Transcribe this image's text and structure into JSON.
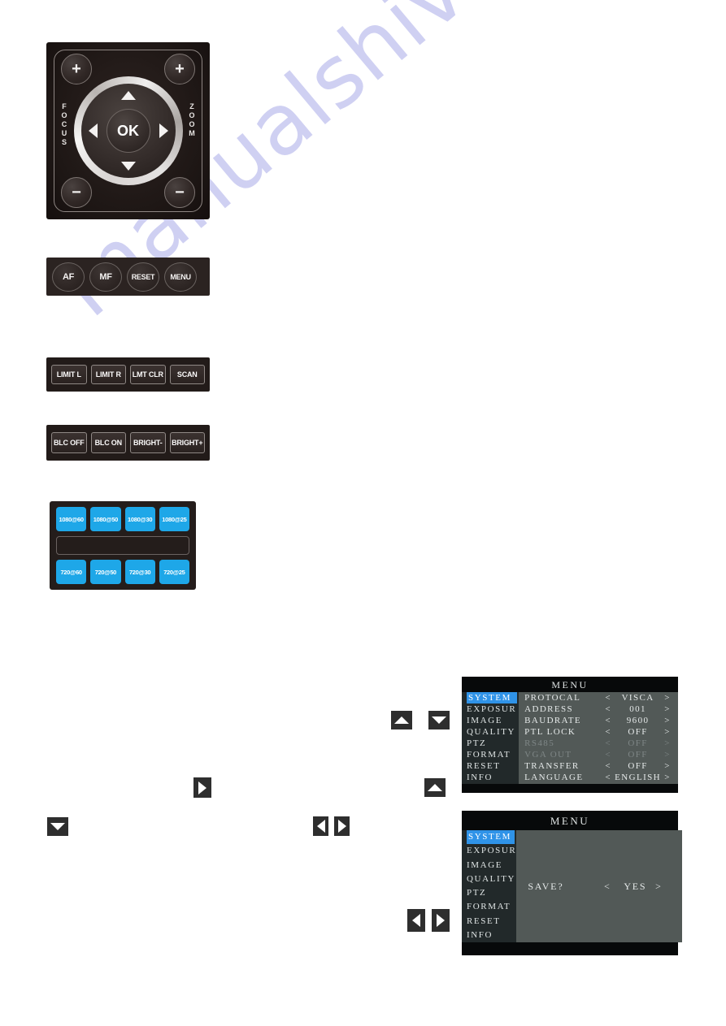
{
  "watermark": {
    "text": "manualshive.com"
  },
  "joystick": {
    "focus_label": "FOCUS",
    "zoom_label": "ZOOM",
    "ok_label": "OK",
    "focus_plus": "+",
    "focus_minus": "−",
    "zoom_plus": "+",
    "zoom_minus": "−",
    "arrows": {
      "up": "up-arrow-icon",
      "down": "down-arrow-icon",
      "left": "left-arrow-icon",
      "right": "right-arrow-icon"
    }
  },
  "round_buttons": [
    {
      "label": "AF"
    },
    {
      "label": "MF"
    },
    {
      "label": "RESET"
    },
    {
      "label": "MENU"
    }
  ],
  "limit_buttons": [
    {
      "label": "LIMIT L"
    },
    {
      "label": "LIMIT R"
    },
    {
      "label": "LMT CLR"
    },
    {
      "label": "SCAN"
    }
  ],
  "blc_buttons": [
    {
      "label": "BLC OFF"
    },
    {
      "label": "BLC ON"
    },
    {
      "label": "BRIGHT-"
    },
    {
      "label": "BRIGHT+"
    }
  ],
  "resolution_keypad": {
    "accent_color": "#1ea7e8",
    "row_top": [
      {
        "label": "1080@60"
      },
      {
        "label": "1080@50"
      },
      {
        "label": "1080@30"
      },
      {
        "label": "1080@25"
      }
    ],
    "row_bottom": [
      {
        "label": "720@60"
      },
      {
        "label": "720@50"
      },
      {
        "label": "720@30"
      },
      {
        "label": "720@25"
      }
    ]
  },
  "osd_main": {
    "title": "MENU",
    "highlight_color": "#2f93e8",
    "sidebar": [
      {
        "label": "SYSTEM",
        "selected": true
      },
      {
        "label": "EXPOSUR",
        "selected": false
      },
      {
        "label": "IMAGE",
        "selected": false
      },
      {
        "label": "QUALITY",
        "selected": false
      },
      {
        "label": "PTZ",
        "selected": false
      },
      {
        "label": "FORMAT",
        "selected": false
      },
      {
        "label": "RESET",
        "selected": false
      },
      {
        "label": "INFO",
        "selected": false
      }
    ],
    "rows": [
      {
        "label": "PROTOCAL",
        "left": "<",
        "value": "VISCA",
        "right": ">",
        "dim": false
      },
      {
        "label": "ADDRESS",
        "left": "<",
        "value": "001",
        "right": ">",
        "dim": false
      },
      {
        "label": "BAUDRATE",
        "left": "<",
        "value": "9600",
        "right": ">",
        "dim": false
      },
      {
        "label": "PTL LOCK",
        "left": "<",
        "value": "OFF",
        "right": ">",
        "dim": false
      },
      {
        "label": "RS485",
        "left": "<",
        "value": "OFF",
        "right": ">",
        "dim": true
      },
      {
        "label": "VGA OUT",
        "left": "<",
        "value": "OFF",
        "right": ">",
        "dim": true
      },
      {
        "label": "TRANSFER",
        "left": "<",
        "value": "OFF",
        "right": ">",
        "dim": false
      },
      {
        "label": "LANGUAGE",
        "left": "<",
        "value": "ENGLISH",
        "right": ">",
        "dim": false
      }
    ]
  },
  "osd_save": {
    "title": "MENU",
    "highlight_color": "#2f93e8",
    "sidebar": [
      {
        "label": "SYSTEM",
        "selected": true
      },
      {
        "label": "EXPOSUR",
        "selected": false
      },
      {
        "label": "IMAGE",
        "selected": false
      },
      {
        "label": "QUALITY",
        "selected": false
      },
      {
        "label": "PTZ",
        "selected": false
      },
      {
        "label": "FORMAT",
        "selected": false
      },
      {
        "label": "RESET",
        "selected": false
      },
      {
        "label": "INFO",
        "selected": false
      }
    ],
    "prompt": {
      "label": "SAVE?",
      "left": "<",
      "value": "YES",
      "right": ">"
    }
  },
  "nav_icons": [
    {
      "name": "down-arrow-icon"
    },
    {
      "name": "right-arrow-icon"
    },
    {
      "name": "left-arrow-icon"
    },
    {
      "name": "right-arrow-icon"
    },
    {
      "name": "up-arrow-icon"
    },
    {
      "name": "down-arrow-icon"
    },
    {
      "name": "up-arrow-icon"
    },
    {
      "name": "left-arrow-icon"
    },
    {
      "name": "right-arrow-icon"
    }
  ]
}
